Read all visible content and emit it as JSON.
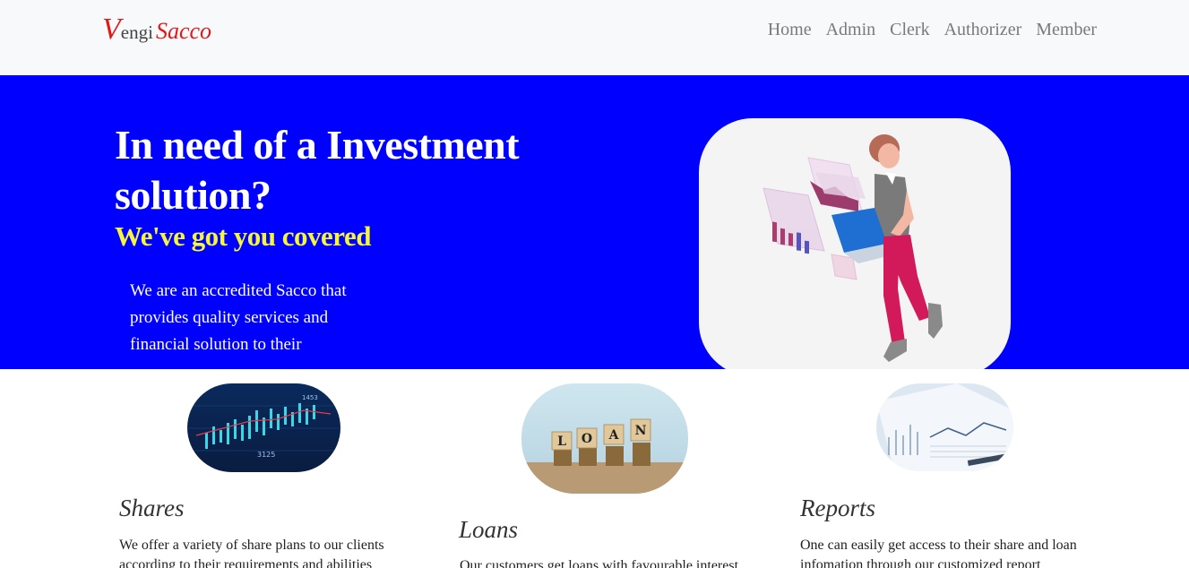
{
  "brand": {
    "v": "V",
    "engi": "engi",
    "sacco": "Sacco"
  },
  "nav": {
    "items": [
      "Home",
      "Admin",
      "Clerk",
      "Authorizer",
      "Member"
    ]
  },
  "hero": {
    "title": "In need of a Investment solution?",
    "subtitle": "We've got you covered",
    "description": "We are an accredited Sacco that provides quality services and financial solution to their",
    "accent_color": "#0000ff",
    "subtitle_color": "#f5f53a"
  },
  "services": [
    {
      "title": "Shares",
      "text": "We offer a variety of share plans to our clients according to their requirements and abilities"
    },
    {
      "title": "Loans",
      "text": "Our customers get loans with favourable interest"
    },
    {
      "title": "Reports",
      "text": "One can easily get access to their share and loan infomation through our customized report"
    }
  ],
  "images": {
    "loan_blocks": [
      "L",
      "O",
      "A",
      "N"
    ],
    "chart_labels": [
      "3125",
      "1453"
    ]
  }
}
